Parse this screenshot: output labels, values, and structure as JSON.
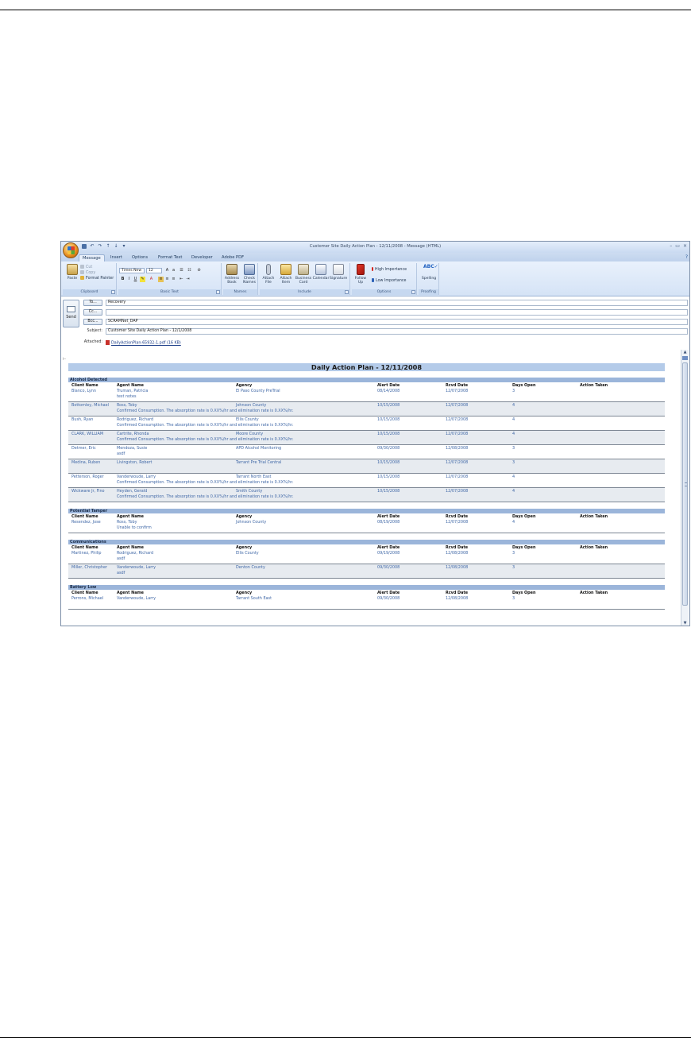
{
  "window": {
    "title": "Customer Site Daily Action Plan - 12/11/2008 - Message (HTML)",
    "controls": [
      "–",
      "▭",
      "×"
    ]
  },
  "ribbon": {
    "tabs": [
      "Message",
      "Insert",
      "Options",
      "Format Text",
      "Developer",
      "Adobe PDF"
    ],
    "active_tab": "Message",
    "clipboard": {
      "paste": "Paste",
      "cut": "Cut",
      "copy": "Copy",
      "format_painter": "Format Painter",
      "label": "Clipboard"
    },
    "basic_text": {
      "font": "Times New",
      "size": "12",
      "label": "Basic Text"
    },
    "names": {
      "address_book": "Address Book",
      "check_names": "Check Names",
      "label": "Names"
    },
    "include": {
      "attach_file": "Attach File",
      "attach_item": "Attach Item",
      "business_card": "Business Card",
      "calendar": "Calendar",
      "signature": "Signature",
      "label": "Include"
    },
    "options": {
      "follow_up": "Follow Up",
      "high_importance": "High Importance",
      "low_importance": "Low Importance",
      "label": "Options"
    },
    "proofing": {
      "spelling": "Spelling",
      "label": "Proofing"
    }
  },
  "header": {
    "send_label": "Send",
    "to_button": "To...",
    "to_value": "Recovery",
    "cc_button": "Cc...",
    "cc_value": "",
    "bcc_button": "Bcc...",
    "bcc_value": "SCRAMNet_DAP",
    "subject_label": "Subject:",
    "subject_value": "Customer Site Daily Action Plan - 12/1/2008",
    "attached_label": "Attached:",
    "attachment": "DailyActionPlan-65932-1.pdf (16 KB)"
  },
  "report": {
    "title": "Daily Action Plan - 12/11/2008",
    "columns": [
      "Client Name",
      "Agent Name",
      "Agency",
      "Alert Date",
      "Rcvd Date",
      "Days Open",
      "Action Taken"
    ],
    "sections": [
      {
        "name": "Alcohol Detected",
        "rows": [
          {
            "client": "Blanco, Lynn",
            "agent": "Truman, Patricia",
            "agency": "El Paso County PreTrial",
            "alert": "08/14/2008",
            "rcvd": "12/07/2008",
            "days": "3",
            "note": "test notes"
          },
          {
            "client": "Bottomley, Michael",
            "agent": "Ross, Toby",
            "agency": "Johnson County",
            "alert": "10/15/2008",
            "rcvd": "12/07/2008",
            "days": "4",
            "note": "Confirmed Consumption. The absorption rate is 0.XX%/hr and elimination rate is 0.XX%/hr."
          },
          {
            "client": "Bush, Ryan",
            "agent": "Rodriguez, Richard",
            "agency": "Ellis County",
            "alert": "10/15/2008",
            "rcvd": "12/07/2008",
            "days": "4",
            "note": "Confirmed Consumption. The absorption rate is 0.XX%/hr and elimination rate is 0.XX%/hr."
          },
          {
            "client": "CLARK, WILLIAM",
            "agent": "Cartrite, Rhonda",
            "agency": "Moore County",
            "alert": "10/15/2008",
            "rcvd": "12/07/2008",
            "days": "4",
            "note": "Confirmed Consumption. The absorption rate is 0.XX%/hr and elimination rate is 0.XX%/hr."
          },
          {
            "client": "Detmer, Eric",
            "agent": "Mendoza, Susie",
            "agency": "APD Alcohol Monitoring",
            "alert": "09/30/2008",
            "rcvd": "12/08/2008",
            "days": "3",
            "note": "asdf"
          },
          {
            "client": "Medina, Ruben",
            "agent": "Livingston, Robert",
            "agency": "Tarrant Pre Trial Central",
            "alert": "10/15/2008",
            "rcvd": "12/07/2008",
            "days": "3",
            "note": ""
          },
          {
            "client": "Petterson, Roger",
            "agent": "Vanderwoude, Larry",
            "agency": "Tarrant North East",
            "alert": "10/15/2008",
            "rcvd": "12/07/2008",
            "days": "4",
            "note": "Confirmed Consumption. The absorption rate is 0.XX%/hr and elimination rate is 0.XX%/hr."
          },
          {
            "client": "Wickware Jr, Fino",
            "agent": "Heyden, Gerald",
            "agency": "Smith County",
            "alert": "10/15/2008",
            "rcvd": "12/07/2008",
            "days": "4",
            "note": "Confirmed Consumption. The absorption rate is 0.XX%/hr and elimination rate is 0.XX%/hr."
          }
        ]
      },
      {
        "name": "Potential Tamper",
        "rows": [
          {
            "client": "Resendez, Jose",
            "agent": "Ross, Toby",
            "agency": "Johnson County",
            "alert": "08/19/2008",
            "rcvd": "12/07/2008",
            "days": "4",
            "note": "Unable to confirm"
          }
        ]
      },
      {
        "name": "Communications",
        "rows": [
          {
            "client": "Martinez, Philip",
            "agent": "Rodriguez, Richard",
            "agency": "Ellis County",
            "alert": "09/19/2008",
            "rcvd": "12/08/2008",
            "days": "3",
            "note": "asdf"
          },
          {
            "client": "Miller, Christopher",
            "agent": "Vanderwoude, Larry",
            "agency": "Denton County",
            "alert": "09/30/2008",
            "rcvd": "12/08/2008",
            "days": "3",
            "note": "asdf"
          }
        ]
      },
      {
        "name": "Battery Low",
        "rows": [
          {
            "client": "Perrons, Michael",
            "agent": "Vanderwoude, Larry",
            "agency": "Tarrant South East",
            "alert": "09/30/2008",
            "rcvd": "12/08/2008",
            "days": "3",
            "note": ""
          }
        ]
      }
    ]
  }
}
